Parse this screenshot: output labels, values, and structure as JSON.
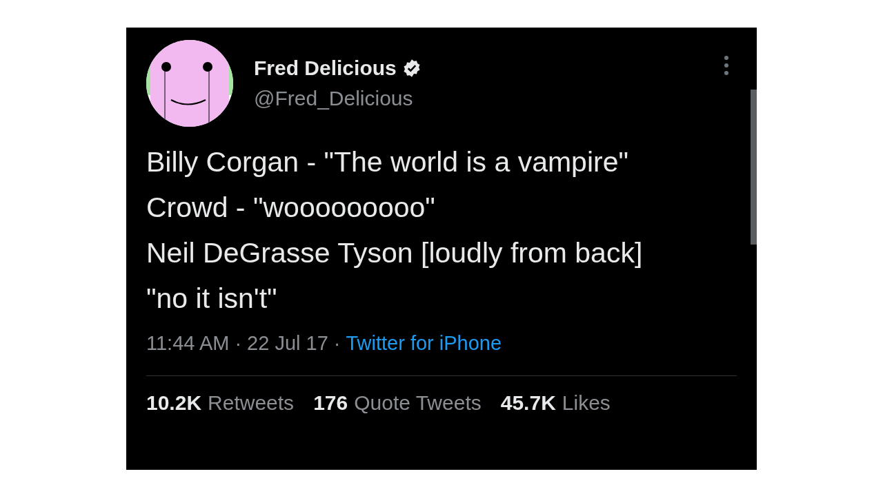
{
  "tweet": {
    "author": {
      "name": "Fred Delicious",
      "handle": "@Fred_Delicious",
      "verified": true
    },
    "body": [
      "Billy Corgan - \"The world is a vampire\"",
      "Crowd - \"wooooooooo\"",
      "Neil DeGrasse Tyson [loudly from back] \"no it isn't\""
    ],
    "meta": {
      "time": "11:44 AM",
      "separator": "·",
      "date": "22 Jul 17",
      "source_separator": "·",
      "source": "Twitter for iPhone"
    },
    "stats": [
      {
        "count": "10.2K",
        "label": "Retweets"
      },
      {
        "count": "176",
        "label": "Quote Tweets"
      },
      {
        "count": "45.7K",
        "label": "Likes"
      }
    ]
  }
}
